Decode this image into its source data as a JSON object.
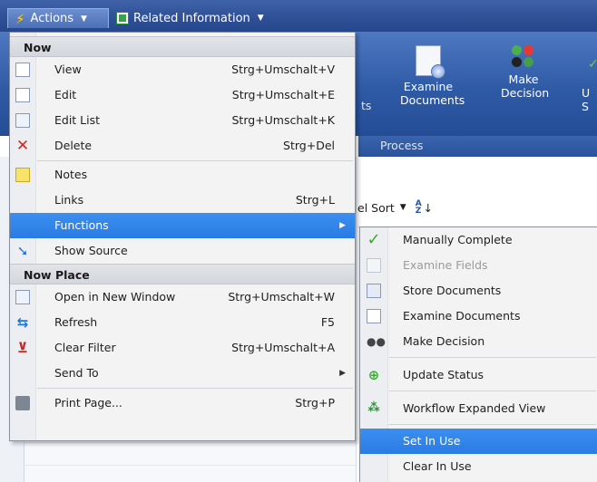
{
  "menubar": {
    "actions_label": "Actions",
    "related_label": "Related Information"
  },
  "ribbon": {
    "examine_documents": "Examine Documents",
    "make_decision": "Make Decision",
    "group_process": "Process",
    "partial_ts": "ts",
    "partial_u": "U\nS"
  },
  "sortbar": {
    "label": "el Sort"
  },
  "menu": {
    "section_now": "Now",
    "section_now_place": "Now Place",
    "items": {
      "view": {
        "label": "View",
        "shortcut": "Strg+Umschalt+V"
      },
      "edit": {
        "label": "Edit",
        "shortcut": "Strg+Umschalt+E"
      },
      "edit_list": {
        "label": "Edit List",
        "shortcut": "Strg+Umschalt+K"
      },
      "delete": {
        "label": "Delete",
        "shortcut": "Strg+Del"
      },
      "notes": {
        "label": "Notes",
        "shortcut": ""
      },
      "links": {
        "label": "Links",
        "shortcut": "Strg+L"
      },
      "functions": {
        "label": "Functions",
        "shortcut": ""
      },
      "show_source": {
        "label": "Show Source",
        "shortcut": ""
      },
      "open_new_window": {
        "label": "Open in New Window",
        "shortcut": "Strg+Umschalt+W"
      },
      "refresh": {
        "label": "Refresh",
        "shortcut": "F5"
      },
      "clear_filter": {
        "label": "Clear Filter",
        "shortcut": "Strg+Umschalt+A"
      },
      "send_to": {
        "label": "Send To",
        "shortcut": ""
      },
      "print_page": {
        "label": "Print Page...",
        "shortcut": "Strg+P"
      }
    }
  },
  "submenu": {
    "items": {
      "manually_complete": "Manually Complete",
      "examine_fields": "Examine Fields",
      "store_documents": "Store Documents",
      "examine_documents": "Examine Documents",
      "make_decision": "Make Decision",
      "update_status": "Update Status",
      "workflow_expanded_view": "Workflow Expanded View",
      "set_in_use": "Set In Use",
      "clear_in_use": "Clear In Use"
    }
  },
  "colors": {
    "highlight": "#2a7be4",
    "menubar": "#2e4e95",
    "ribbon": "#2f5aa6"
  }
}
